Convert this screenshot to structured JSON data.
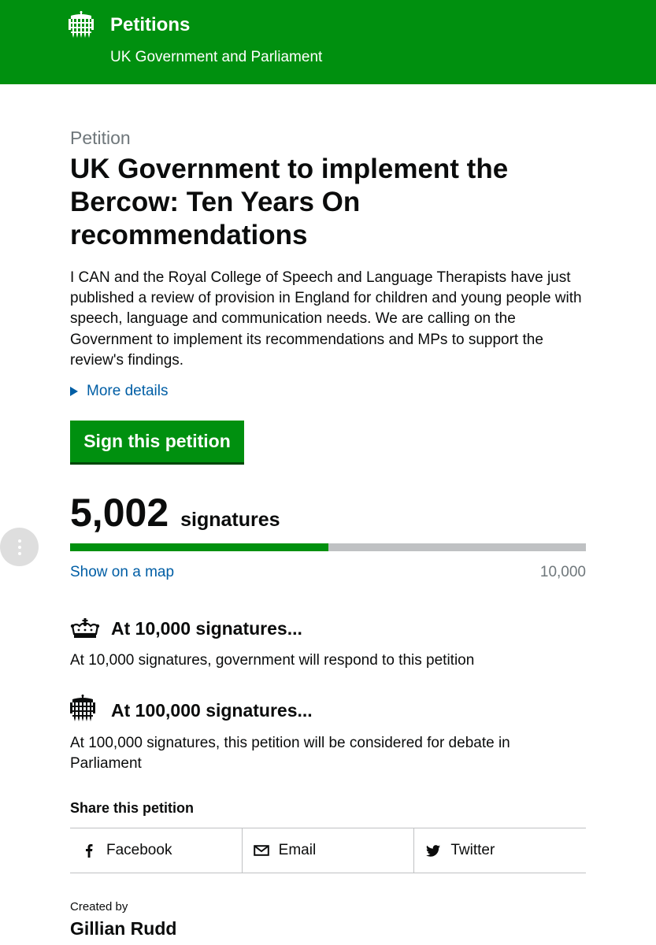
{
  "header": {
    "title": "Petitions",
    "subtitle": "UK Government and Parliament",
    "logo_icon": "portcullis-icon",
    "background_color": "#00900f"
  },
  "petition": {
    "kicker": "Petition",
    "title": "UK Government to implement the Bercow: Ten Years On recommendations",
    "summary": "I CAN and the Royal College of Speech and Language Therapists have just published a review of provision in England for children and young people with speech, language and communication needs. We are calling on the Government to implement its recommendations and MPs to support the review's findings.",
    "more_details": "More details",
    "sign_button": "Sign this petition"
  },
  "signatures": {
    "count": "5,002",
    "label": "signatures",
    "progress_fraction": 0.5002,
    "map_link": "Show on a map",
    "goal": "10,000"
  },
  "thresholds": [
    {
      "icon": "crown-icon",
      "heading": "At 10,000 signatures...",
      "text": "At 10,000 signatures, government will respond to this petition"
    },
    {
      "icon": "portcullis-icon",
      "heading": "At 100,000 signatures...",
      "text": "At 100,000 signatures, this petition will be considered for debate in Parliament"
    }
  ],
  "share": {
    "title": "Share this petition",
    "items": [
      {
        "icon": "facebook-icon",
        "label": "Facebook"
      },
      {
        "icon": "email-icon",
        "label": "Email"
      },
      {
        "icon": "twitter-icon",
        "label": "Twitter"
      }
    ]
  },
  "creator": {
    "label": "Created by",
    "name": "Gillian Rudd"
  },
  "colors": {
    "brand_green": "#00900f",
    "link_blue": "#005ea5",
    "muted_grey": "#6f777b"
  }
}
